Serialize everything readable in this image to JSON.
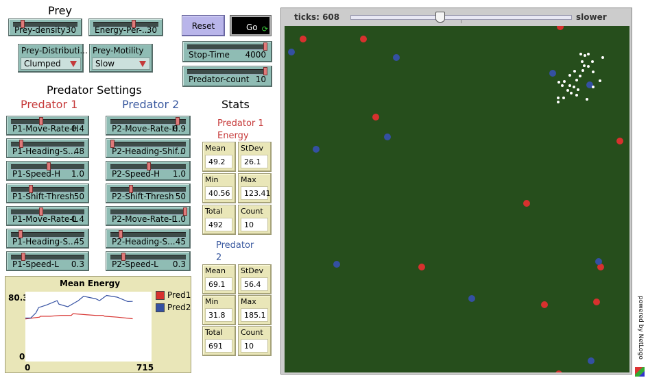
{
  "prey": {
    "title": "Prey",
    "density": {
      "label": "Prey-density",
      "value": "30",
      "level": 0.3
    },
    "energy": {
      "label": "Energy-Per-...",
      "value": "30",
      "level": 0.55
    },
    "distribution": {
      "label": "Prey-Distributi...",
      "selected": "Clumped"
    },
    "motility": {
      "label": "Prey-Motility",
      "selected": "Slow"
    }
  },
  "controls": {
    "reset_label": "Reset",
    "go_label": "Go",
    "stop_time": {
      "label": "Stop-Time",
      "value": "4000",
      "level": 1.0
    },
    "predator_count": {
      "label": "Predator-count",
      "value": "10",
      "level": 1.0
    }
  },
  "predator_settings": {
    "title": "Predator Settings",
    "p1_title": "Predator 1",
    "p2_title": "Predator 2",
    "p1": [
      {
        "label": "P1-Move-Rate-H",
        "value": "0.4",
        "level": 0.4
      },
      {
        "label": "P1-Heading-S...",
        "value": "48",
        "level": 0.12
      },
      {
        "label": "P1-Speed-H",
        "value": "1.0",
        "level": 0.5
      },
      {
        "label": "P1-Shift-Thresh",
        "value": "50",
        "level": 0.25
      },
      {
        "label": "P1-Move-Rate-L",
        "value": "0.4",
        "level": 0.4
      },
      {
        "label": "P1-Heading-S...",
        "value": "45",
        "level": 0.11
      },
      {
        "label": "P1-Speed-L",
        "value": "0.3",
        "level": 0.15
      }
    ],
    "p2": [
      {
        "label": "P2-Move-Rate-H",
        "value": "0.9",
        "level": 0.9
      },
      {
        "label": "P2-Heading-Shif...",
        "value": "0",
        "level": 0.0
      },
      {
        "label": "P2-Speed-H",
        "value": "1.0",
        "level": 0.5
      },
      {
        "label": "P2-Shift-Thresh",
        "value": "50",
        "level": 0.25
      },
      {
        "label": "P2-Move-Rate-L",
        "value": "1.0",
        "level": 1.0
      },
      {
        "label": "P2-Heading-S...",
        "value": "45",
        "level": 0.11
      },
      {
        "label": "P2-Speed-L",
        "value": "0.3",
        "level": 0.15
      }
    ]
  },
  "stats": {
    "title": "Stats",
    "p1_title_line1": "Predator 1",
    "p1_title_line2": "Energy",
    "p2_title_line1": "Predator",
    "p2_title_line2": "2",
    "p1": {
      "mean": {
        "label": "Mean",
        "value": "49.2"
      },
      "stdev": {
        "label": "StDev",
        "value": "26.1"
      },
      "min": {
        "label": "Min",
        "value": "40.56"
      },
      "max": {
        "label": "Max",
        "value": "123.41"
      },
      "total": {
        "label": "Total",
        "value": "492"
      },
      "count": {
        "label": "Count",
        "value": "10"
      }
    },
    "p2": {
      "mean": {
        "label": "Mean",
        "value": "69.1"
      },
      "stdev": {
        "label": "StDev",
        "value": "56.4"
      },
      "min": {
        "label": "Min",
        "value": "31.8"
      },
      "max": {
        "label": "Max",
        "value": "185.1"
      },
      "total": {
        "label": "Total",
        "value": "691"
      },
      "count": {
        "label": "Count",
        "value": "10"
      }
    }
  },
  "plot": {
    "title": "Mean Energy",
    "ymax_label": "80.3",
    "ymin_label": "0",
    "xmin_label": "0",
    "xmax_label": "715",
    "legend": [
      {
        "name": "Pred1",
        "color": "#d7312e"
      },
      {
        "name": "Pred2",
        "color": "#3450a2"
      }
    ]
  },
  "chart_data": {
    "type": "line",
    "title": "Mean Energy",
    "xlim": [
      0,
      715
    ],
    "ylim": [
      0,
      80.3
    ],
    "series": [
      {
        "name": "Pred1",
        "x": [
          0,
          40,
          80,
          85,
          140,
          200,
          260,
          270,
          330,
          400,
          440,
          450,
          520,
          608
        ],
        "y": [
          49,
          50,
          51,
          52,
          52,
          53,
          53,
          55,
          54,
          53,
          53,
          52,
          51,
          49.2
        ]
      },
      {
        "name": "Pred2",
        "x": [
          0,
          30,
          60,
          75,
          120,
          180,
          190,
          240,
          300,
          330,
          400,
          420,
          460,
          520,
          580,
          608
        ],
        "y": [
          50,
          50,
          56,
          62,
          65,
          70,
          66,
          63,
          70,
          75,
          72,
          70,
          76,
          74,
          69,
          69.1
        ]
      }
    ]
  },
  "world": {
    "ticks_label": "ticks: 608",
    "speed_label": "slower",
    "powered_by": "powered by NetLogo"
  },
  "colors": {
    "slider": "#8fbcb4",
    "monitor": "#e9e6b8",
    "button": "#b9b5ea",
    "field": "#264e1c",
    "pred1": "#d7312e",
    "pred2": "#3450a2",
    "prey": "#ffffff"
  }
}
